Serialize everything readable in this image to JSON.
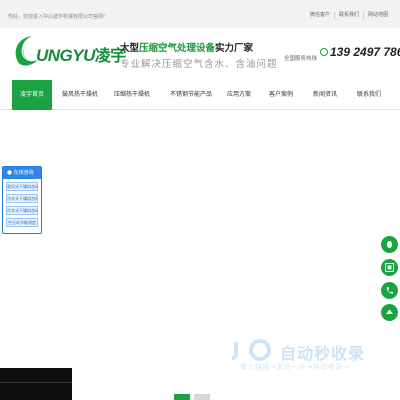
{
  "topbar": {
    "welcome": "你好，欢迎进入中山凌宇机械有限公司官网!",
    "links": [
      "微信客户",
      "联系我们",
      "网站地图"
    ]
  },
  "header": {
    "logo_text": "UNGYU",
    "logo_cn": "凌宇",
    "slogan_pre": "大型",
    "slogan_highlight": "压缩空气处理设备",
    "slogan_post": "实力厂家",
    "slogan_sub": "专业解决压缩空气含水、含油问题",
    "hotline_label": "全国服务热线",
    "hotline_number": "139 2497 7862"
  },
  "nav": {
    "items": [
      "凌宇首页",
      "鼓风热干燥机",
      "压缩热干燥机",
      "不锈钢节能产品",
      "应用方案",
      "客户案例",
      "新闻资讯",
      "联系我们"
    ]
  },
  "float_panel": {
    "title": "在线咨询",
    "items": [
      "鼓风式干燥机咨询",
      "冷冻式干燥机咨询",
      "冷冻式干燥机咨询",
      "空压站节能改造"
    ]
  },
  "right_buttons": [
    "qq-icon",
    "wechat-qr-icon",
    "phone-icon",
    "top-icon"
  ],
  "watermark": {
    "title": "自动秒收录",
    "subtitle": "做上链接→来访一次→自动收录→"
  },
  "colors": {
    "brand_green": "#1aa343",
    "float_blue": "#2f86e8"
  }
}
